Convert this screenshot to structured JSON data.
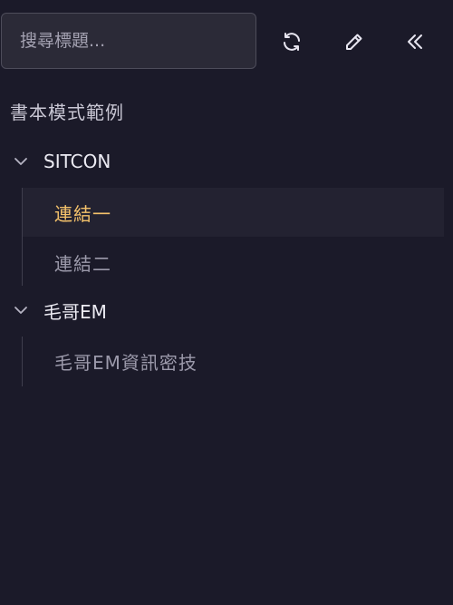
{
  "search": {
    "placeholder": "搜尋標題...",
    "value": ""
  },
  "toolbar": {
    "refresh_icon": "refresh-icon",
    "edit_icon": "pencil-icon",
    "collapse_icon": "double-chevron-left-icon"
  },
  "book": {
    "title": "書本模式範例"
  },
  "sections": [
    {
      "label": "SITCON",
      "expanded": true,
      "items": [
        {
          "label": "連結一",
          "active": true
        },
        {
          "label": "連結二",
          "active": false
        }
      ]
    },
    {
      "label": "毛哥EM",
      "expanded": true,
      "items": [
        {
          "label": "毛哥EM資訊密技",
          "active": false
        }
      ]
    }
  ],
  "colors": {
    "background": "#1b1a29",
    "active_item_text": "#f4c26b",
    "active_item_bg": "#232231",
    "inactive_item_text": "#9c9aab"
  }
}
